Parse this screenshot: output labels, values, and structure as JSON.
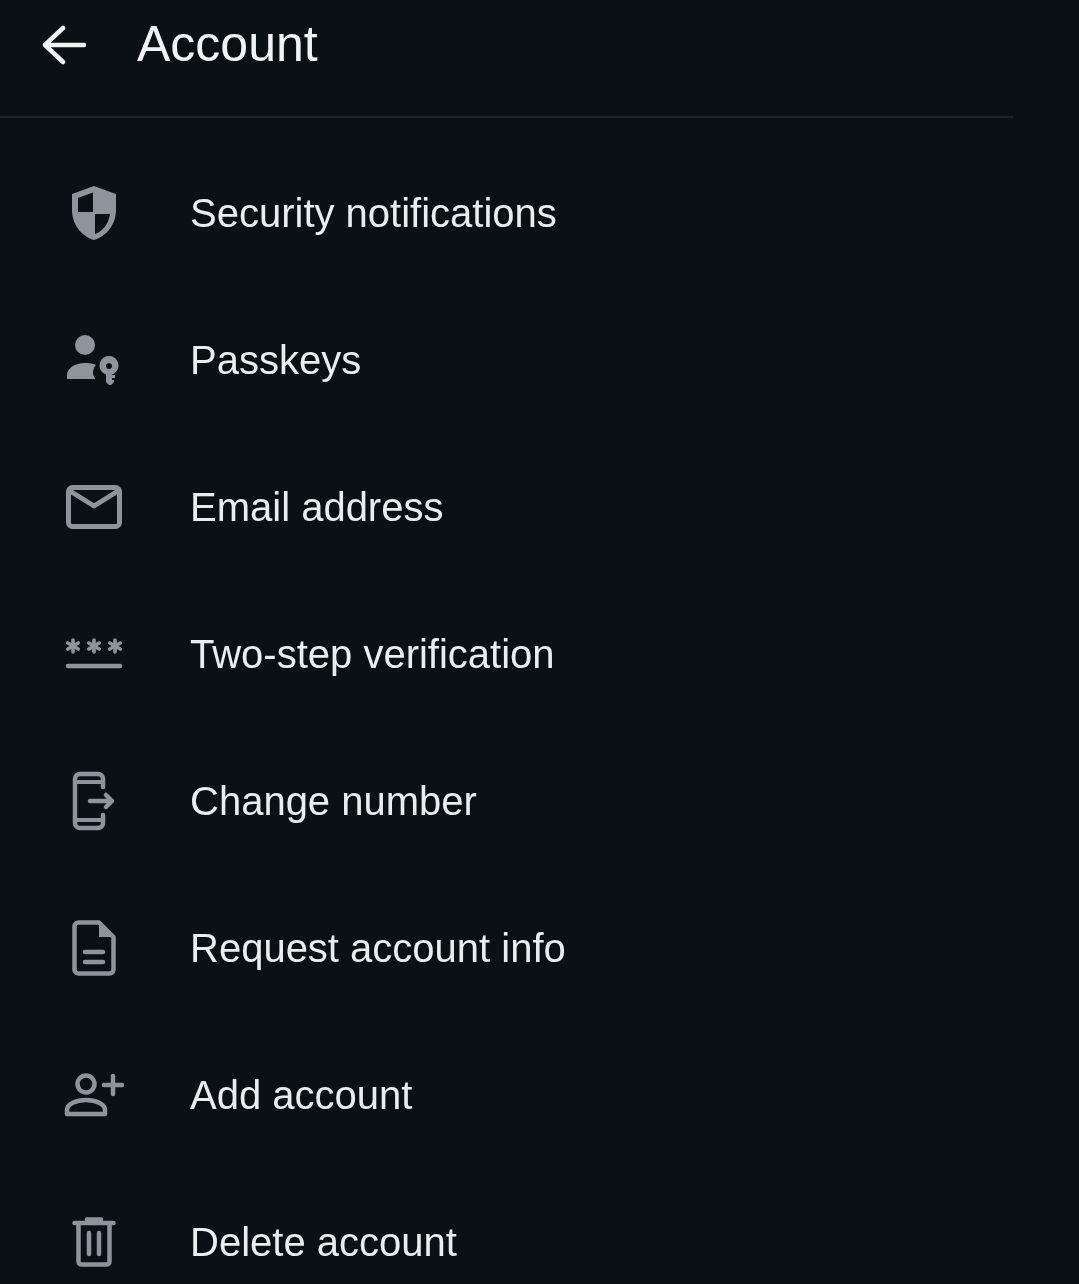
{
  "header": {
    "title": "Account"
  },
  "items": [
    {
      "label": "Security notifications"
    },
    {
      "label": "Passkeys"
    },
    {
      "label": "Email address"
    },
    {
      "label": "Two-step verification"
    },
    {
      "label": "Change number"
    },
    {
      "label": "Request account info"
    },
    {
      "label": "Add account"
    },
    {
      "label": "Delete account"
    }
  ]
}
